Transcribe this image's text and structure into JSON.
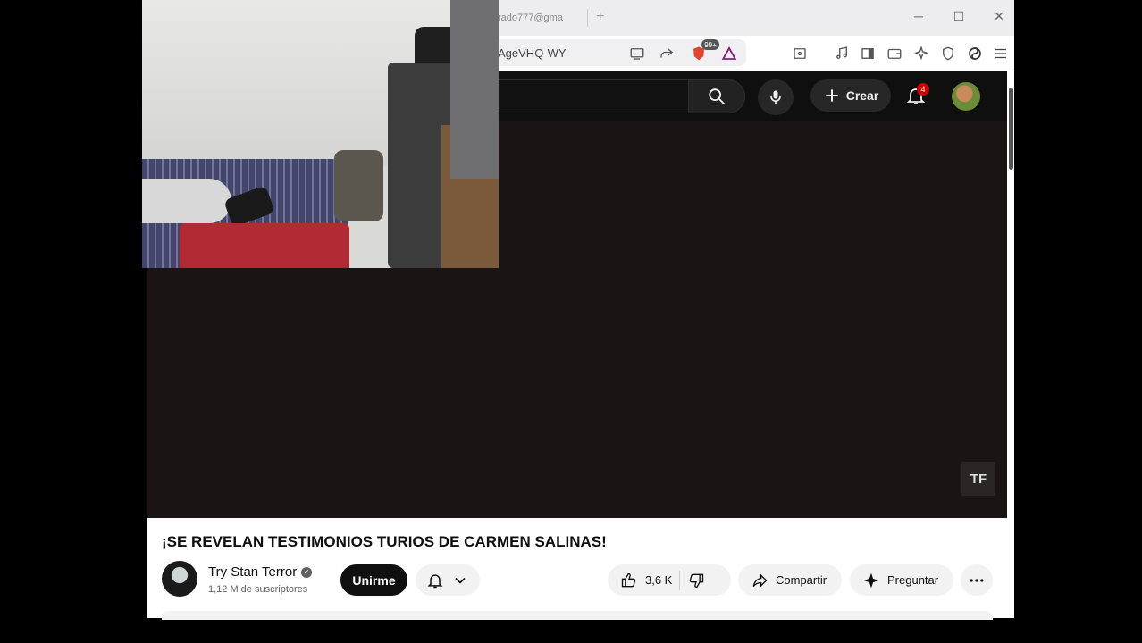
{
  "browser": {
    "tab_title": "rado777@gma",
    "url": "AgeVHQ-WY",
    "brave_badge": "99+",
    "window_controls": {
      "minimize": "─",
      "maximize": "☐",
      "close": "✕"
    }
  },
  "youtube": {
    "create_label": "Crear",
    "notification_count": "4",
    "logo_overlay": "TF",
    "video": {
      "title": "¡SE REVELAN TESTIMONIOS TURIOS DE CARMEN SALINAS!",
      "channel_name": "Try Stan Terror",
      "subscribers": "1,12 M de suscriptores",
      "join_label": "Unirme",
      "likes": "3,6 K",
      "share_label": "Compartir",
      "ask_label": "Preguntar"
    }
  },
  "colors": {
    "yt_dark": "#0f0f0f",
    "video_bg": "#1a1414",
    "badge_red": "#cc0000",
    "pill_bg": "#f2f2f2"
  }
}
